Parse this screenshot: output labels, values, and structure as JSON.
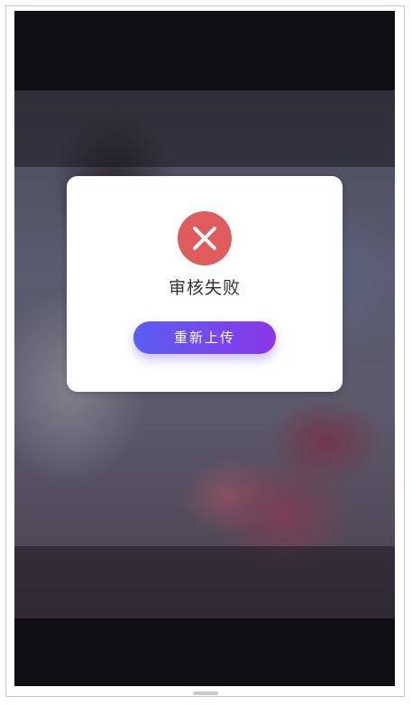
{
  "dialog": {
    "status_icon": "close-icon",
    "status_text": "审核失败",
    "retry_label": "重新上传"
  },
  "colors": {
    "fail_icon": "#e05c5c",
    "button_gradient_start": "#5a5ef0",
    "button_gradient_end": "#8a37ea"
  }
}
